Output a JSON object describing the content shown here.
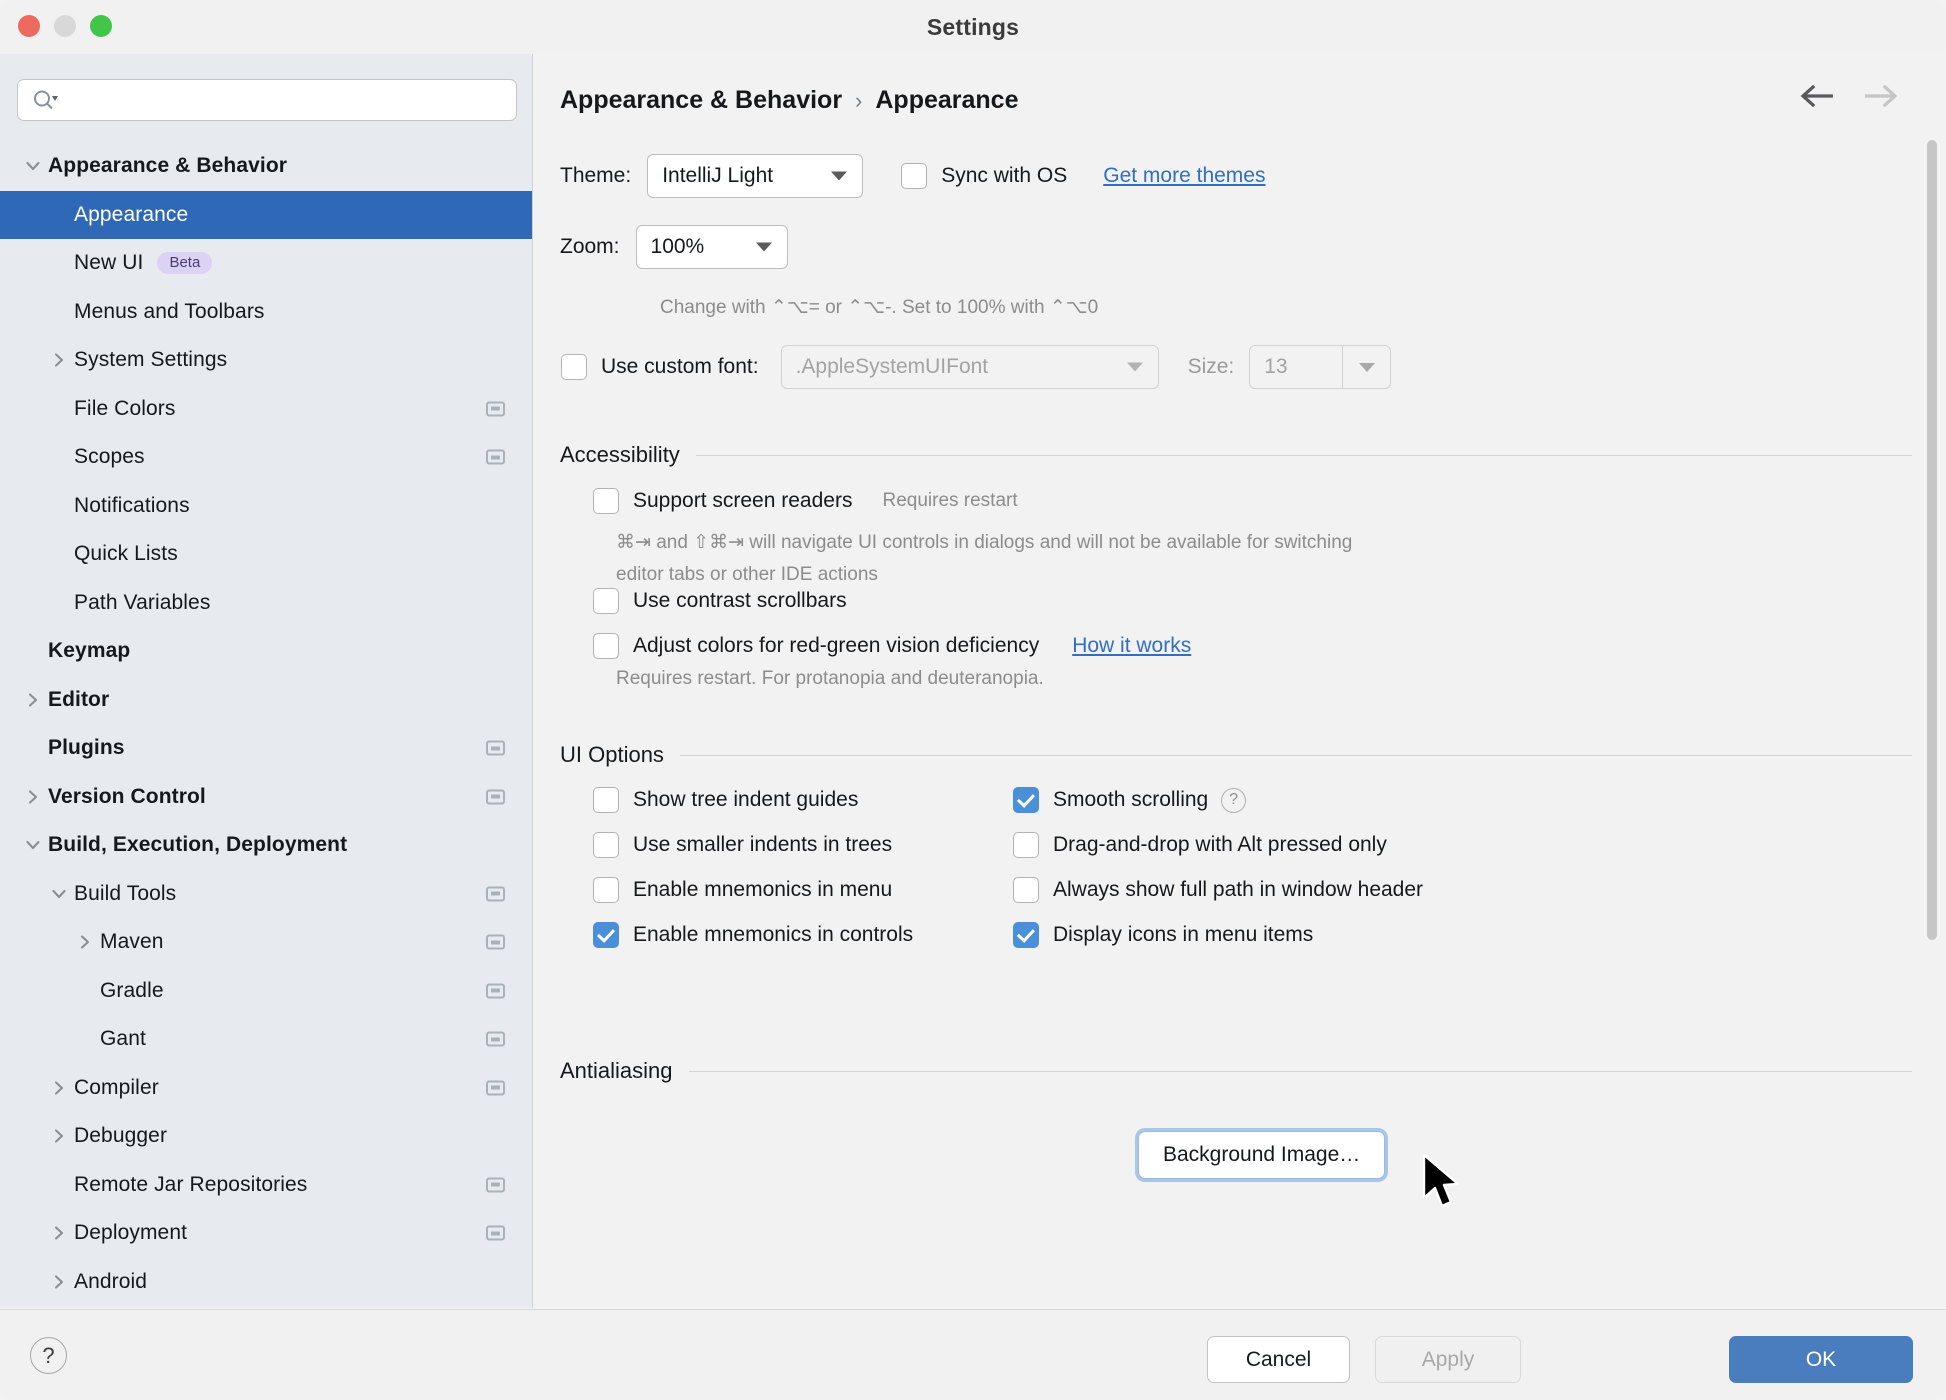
{
  "window": {
    "title": "Settings",
    "traffic_lights": [
      "close",
      "minimize",
      "zoom"
    ]
  },
  "sidebar": {
    "search": {
      "value": "",
      "placeholder": ""
    },
    "items": [
      {
        "label": "Appearance & Behavior",
        "level": 0,
        "bold": true,
        "chevron": "down",
        "selected": false,
        "badge": "",
        "project_icon": false
      },
      {
        "label": "Appearance",
        "level": 1,
        "bold": false,
        "chevron": "",
        "selected": true,
        "badge": "",
        "project_icon": false
      },
      {
        "label": "New UI",
        "level": 1,
        "bold": false,
        "chevron": "",
        "selected": false,
        "badge": "Beta",
        "project_icon": false
      },
      {
        "label": "Menus and Toolbars",
        "level": 1,
        "bold": false,
        "chevron": "",
        "selected": false,
        "badge": "",
        "project_icon": false
      },
      {
        "label": "System Settings",
        "level": 1,
        "bold": false,
        "chevron": "right",
        "selected": false,
        "badge": "",
        "project_icon": false
      },
      {
        "label": "File Colors",
        "level": 1,
        "bold": false,
        "chevron": "",
        "selected": false,
        "badge": "",
        "project_icon": true
      },
      {
        "label": "Scopes",
        "level": 1,
        "bold": false,
        "chevron": "",
        "selected": false,
        "badge": "",
        "project_icon": true
      },
      {
        "label": "Notifications",
        "level": 1,
        "bold": false,
        "chevron": "",
        "selected": false,
        "badge": "",
        "project_icon": false
      },
      {
        "label": "Quick Lists",
        "level": 1,
        "bold": false,
        "chevron": "",
        "selected": false,
        "badge": "",
        "project_icon": false
      },
      {
        "label": "Path Variables",
        "level": 1,
        "bold": false,
        "chevron": "",
        "selected": false,
        "badge": "",
        "project_icon": false
      },
      {
        "label": "Keymap",
        "level": 0,
        "bold": true,
        "chevron": "",
        "selected": false,
        "badge": "",
        "project_icon": false
      },
      {
        "label": "Editor",
        "level": 0,
        "bold": true,
        "chevron": "right",
        "selected": false,
        "badge": "",
        "project_icon": false
      },
      {
        "label": "Plugins",
        "level": 0,
        "bold": true,
        "chevron": "",
        "selected": false,
        "badge": "",
        "project_icon": true
      },
      {
        "label": "Version Control",
        "level": 0,
        "bold": true,
        "chevron": "right",
        "selected": false,
        "badge": "",
        "project_icon": true
      },
      {
        "label": "Build, Execution, Deployment",
        "level": 0,
        "bold": true,
        "chevron": "down",
        "selected": false,
        "badge": "",
        "project_icon": false
      },
      {
        "label": "Build Tools",
        "level": 1,
        "bold": false,
        "chevron": "down",
        "selected": false,
        "badge": "",
        "project_icon": true
      },
      {
        "label": "Maven",
        "level": 2,
        "bold": false,
        "chevron": "right",
        "selected": false,
        "badge": "",
        "project_icon": true
      },
      {
        "label": "Gradle",
        "level": 2,
        "bold": false,
        "chevron": "",
        "selected": false,
        "badge": "",
        "project_icon": true
      },
      {
        "label": "Gant",
        "level": 2,
        "bold": false,
        "chevron": "",
        "selected": false,
        "badge": "",
        "project_icon": true
      },
      {
        "label": "Compiler",
        "level": 1,
        "bold": false,
        "chevron": "right",
        "selected": false,
        "badge": "",
        "project_icon": true
      },
      {
        "label": "Debugger",
        "level": 1,
        "bold": false,
        "chevron": "right",
        "selected": false,
        "badge": "",
        "project_icon": false
      },
      {
        "label": "Remote Jar Repositories",
        "level": 1,
        "bold": false,
        "chevron": "",
        "selected": false,
        "badge": "",
        "project_icon": true
      },
      {
        "label": "Deployment",
        "level": 1,
        "bold": false,
        "chevron": "right",
        "selected": false,
        "badge": "",
        "project_icon": true
      },
      {
        "label": "Android",
        "level": 1,
        "bold": false,
        "chevron": "right",
        "selected": false,
        "badge": "",
        "project_icon": false
      }
    ]
  },
  "content": {
    "breadcrumb": {
      "parent": "Appearance & Behavior",
      "separator": "›",
      "current": "Appearance"
    },
    "nav": {
      "back": "back-arrow",
      "forward": "forward-arrow"
    },
    "theme": {
      "label": "Theme:",
      "value": "IntelliJ Light",
      "sync_with_os_label": "Sync with OS",
      "sync_with_os_checked": false,
      "get_more_themes": "Get more themes"
    },
    "zoom": {
      "label": "Zoom:",
      "value": "100%",
      "hint": "Change with ⌃⌥= or ⌃⌥-. Set to 100% with ⌃⌥0"
    },
    "custom_font": {
      "checkbox_label": "Use custom font:",
      "checked": false,
      "font_value": ".AppleSystemUIFont",
      "size_label": "Size:",
      "size_value": "13"
    },
    "accessibility": {
      "section_title": "Accessibility",
      "screen_readers_label": "Support screen readers",
      "screen_readers_checked": false,
      "screen_readers_note": "Requires restart",
      "screen_readers_hint_line1": "⌘⇥ and ⇧⌘⇥ will navigate UI controls in dialogs and will not be available for switching",
      "screen_readers_hint_line2": "editor tabs or other IDE actions",
      "contrast_scrollbars_label": "Use contrast scrollbars",
      "contrast_scrollbars_checked": false,
      "red_green_label": "Adjust colors for red-green vision deficiency",
      "red_green_checked": false,
      "how_it_works": "How it works",
      "red_green_hint": "Requires restart. For protanopia and deuteranopia."
    },
    "ui_options": {
      "section_title": "UI Options",
      "left": [
        {
          "label": "Show tree indent guides",
          "checked": false
        },
        {
          "label": "Use smaller indents in trees",
          "checked": false
        },
        {
          "label": "Enable mnemonics in menu",
          "checked": false
        },
        {
          "label": "Enable mnemonics in controls",
          "checked": true
        }
      ],
      "right": [
        {
          "label": "Smooth scrolling",
          "checked": true,
          "help": true
        },
        {
          "label": "Drag-and-drop with Alt pressed only",
          "checked": false,
          "help": false
        },
        {
          "label": "Always show full path in window header",
          "checked": false,
          "help": false
        },
        {
          "label": "Display icons in menu items",
          "checked": true,
          "help": false
        }
      ],
      "background_image_button": "Background Image…"
    },
    "antialiasing": {
      "section_title": "Antialiasing"
    }
  },
  "footer": {
    "help": "?",
    "cancel": "Cancel",
    "apply": "Apply",
    "ok": "OK"
  },
  "colors": {
    "selection": "#2e68b6",
    "accent": "#4a90d9",
    "link": "#2f6fc4",
    "primary_button": "#4a7dbd",
    "badge_bg": "#dcd2f3",
    "sidebar_bg": "#e7eaee"
  }
}
